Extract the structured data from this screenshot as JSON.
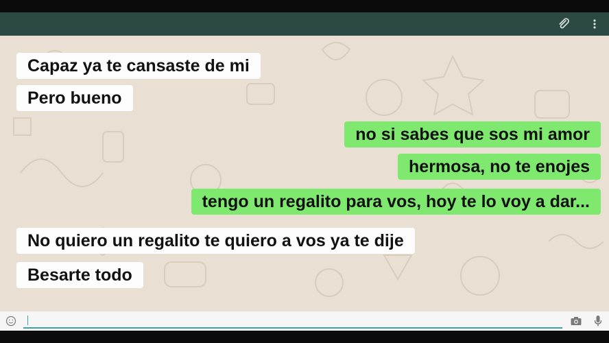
{
  "colors": {
    "header": "#2c4a43",
    "chat_background": "#e9e0d3",
    "incoming_bubble": "#fdfdfd",
    "outgoing_bubble": "#7fe86e",
    "input_accent": "#3aa5a0"
  },
  "header": {
    "icons": [
      "paperclip-icon",
      "more-vert-icon"
    ]
  },
  "messages": [
    {
      "direction": "incoming",
      "text": "Capaz ya te cansaste de mi"
    },
    {
      "direction": "incoming",
      "text": "Pero bueno"
    },
    {
      "direction": "outgoing",
      "text": "no si sabes que sos mi amor"
    },
    {
      "direction": "outgoing",
      "text": "hermosa, no te enojes"
    },
    {
      "direction": "outgoing",
      "text": "tengo un regalito para vos, hoy te lo voy a dar..."
    },
    {
      "direction": "incoming",
      "text": "No quiero un regalito te quiero a vos ya te dije"
    },
    {
      "direction": "incoming",
      "text": "Besarte todo"
    }
  ],
  "input": {
    "value": "",
    "icons": [
      "emoji-icon",
      "camera-icon",
      "microphone-icon"
    ]
  }
}
